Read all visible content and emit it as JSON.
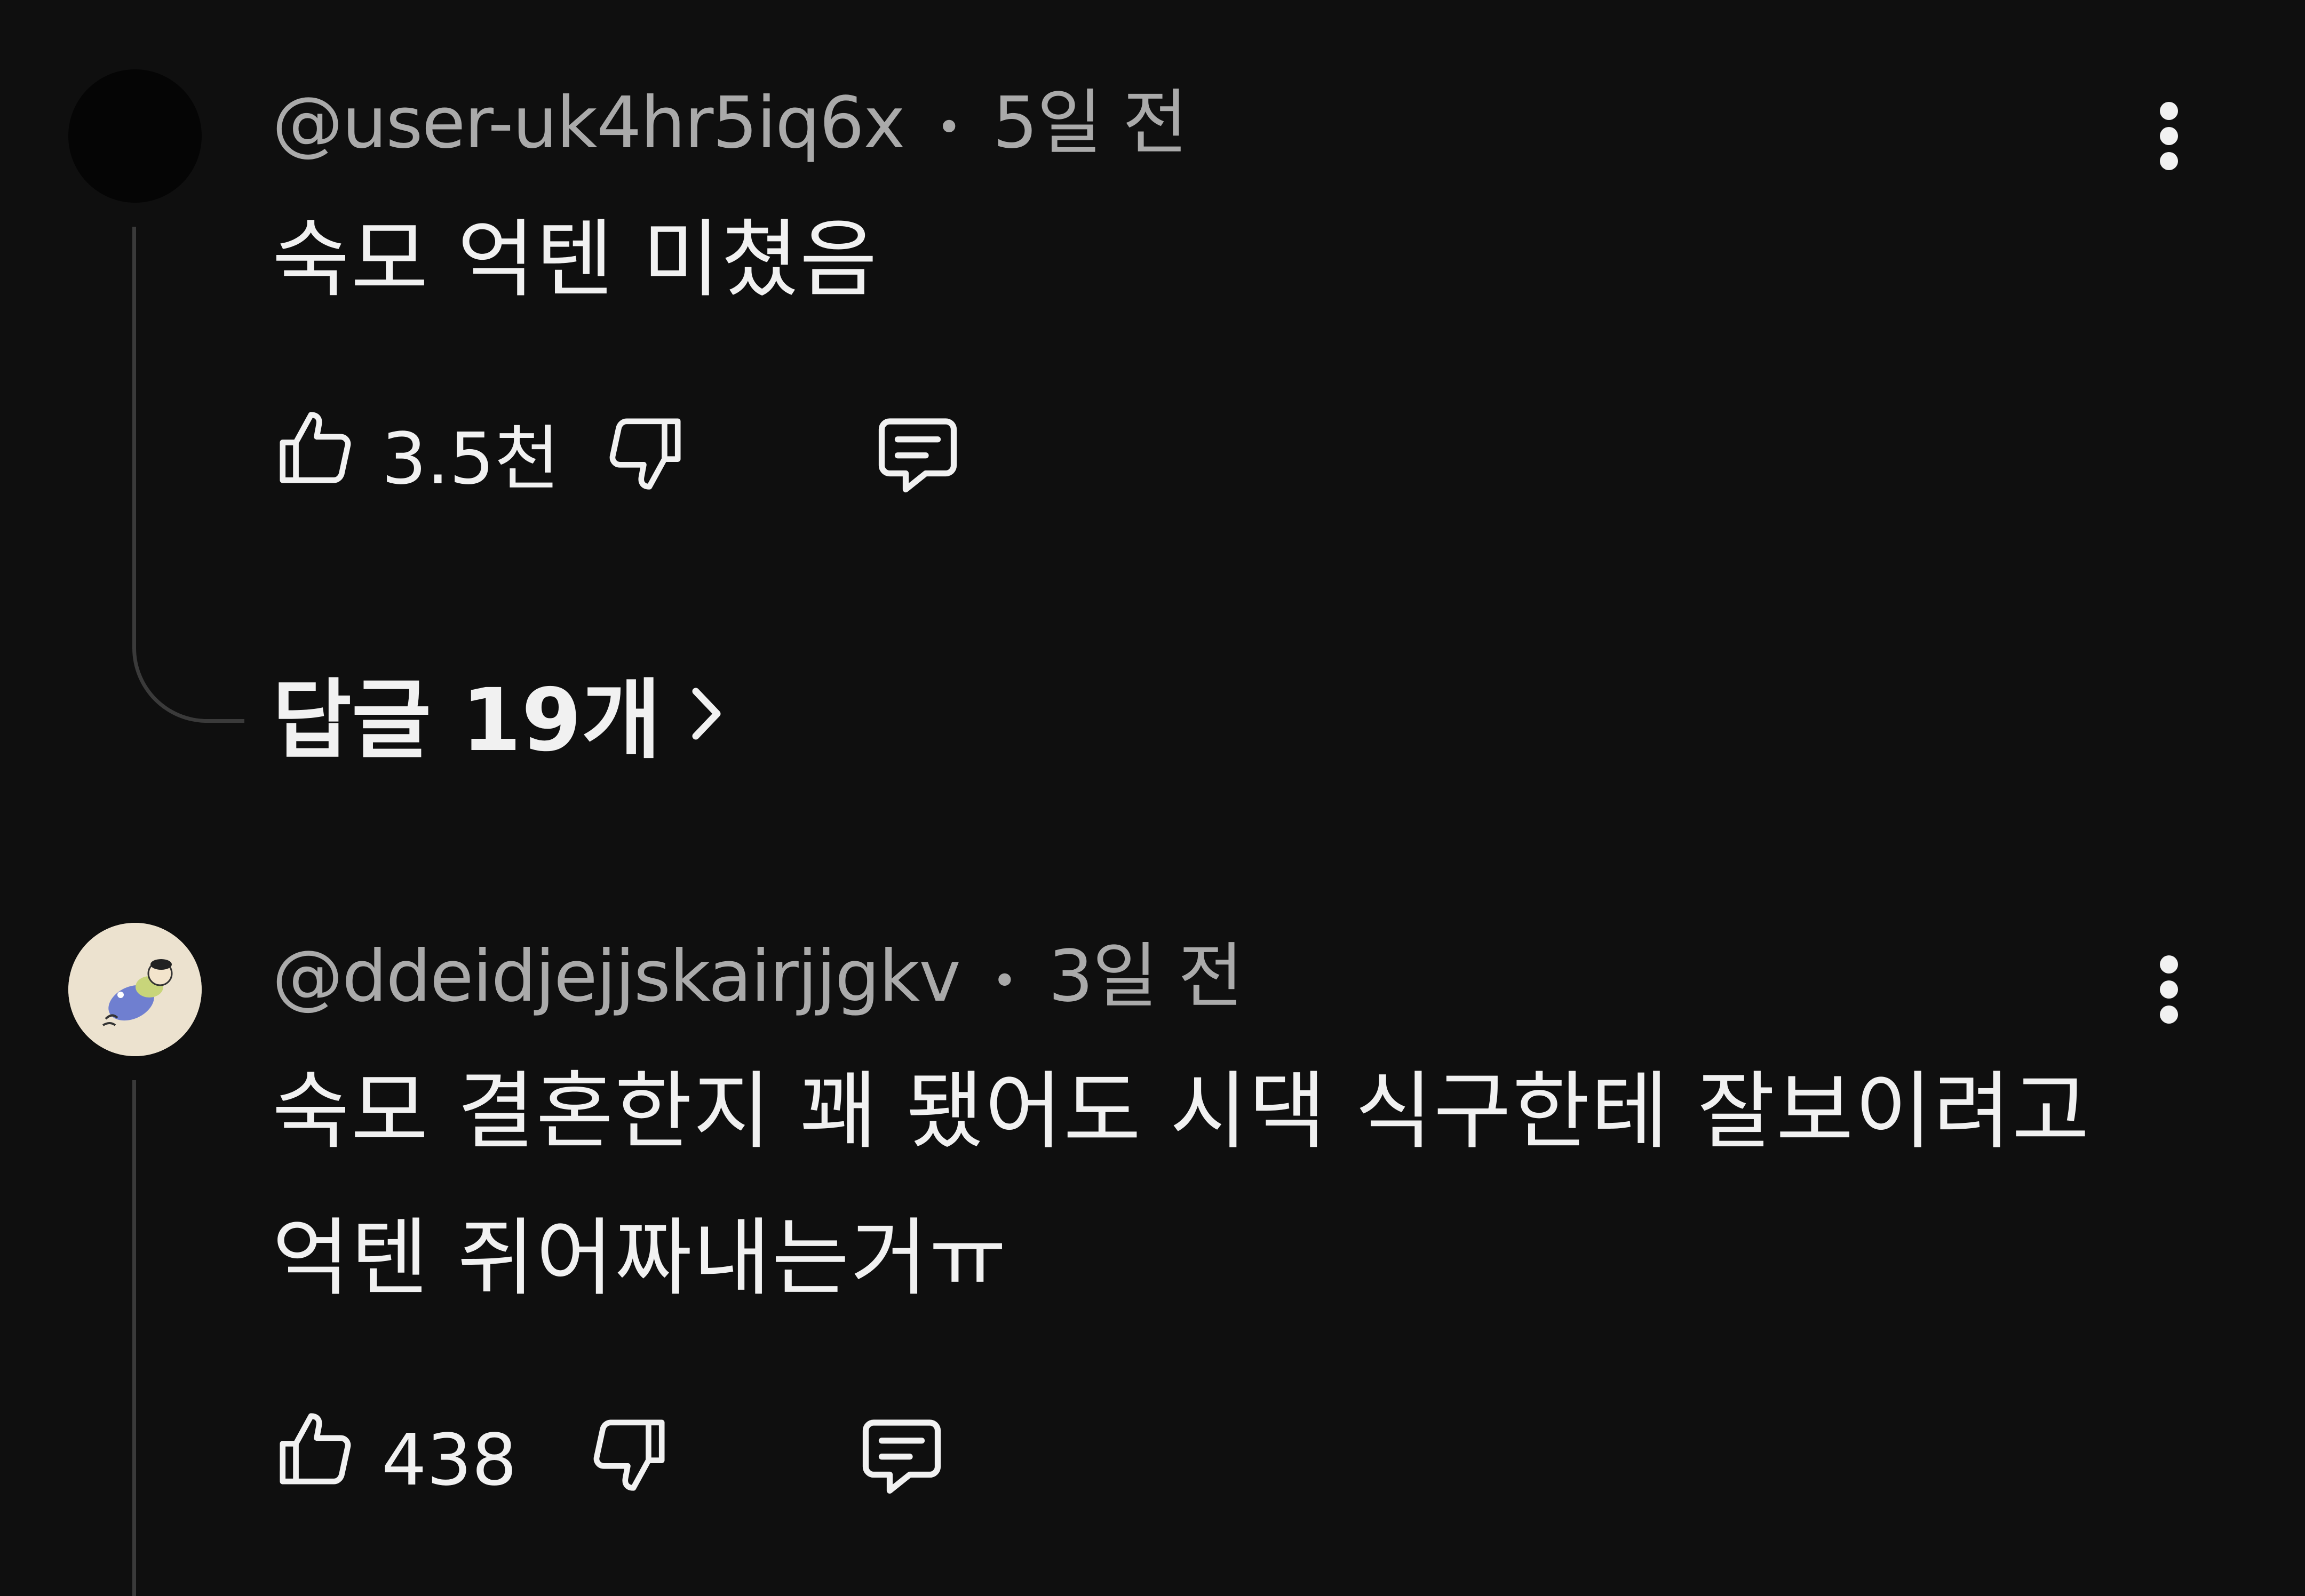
{
  "comments": [
    {
      "handle": "@user-uk4hr5iq6x",
      "separator": "•",
      "time": "5일 전",
      "text_lines": [
        "숙모 억텐 미쳤음"
      ],
      "likes": "3.5천",
      "replies_label": "답글 19개",
      "avatar_icon": "dark-circle-avatar"
    },
    {
      "handle": "@ddeidjejjskairjjgkv",
      "separator": "•",
      "time": "3일 전",
      "text_lines": [
        "숙모 결혼한지 꽤 됐어도 시댁 식구한테 잘보이려고",
        "억텐 쥐어짜내는거ㅠ"
      ],
      "likes": "438",
      "avatar_icon": "illustrated-figure-avatar"
    }
  ],
  "icons": {
    "like": "thumbs-up-icon",
    "dislike": "thumbs-down-icon",
    "reply": "reply-bubble-icon",
    "menu": "more-vertical-icon",
    "chevron": "chevron-right-icon"
  },
  "colors": {
    "background": "#0f0f0f",
    "primary_text": "#f1f1f1",
    "secondary_text": "#aaaaaa",
    "thread_line": "#3a3a3a"
  }
}
